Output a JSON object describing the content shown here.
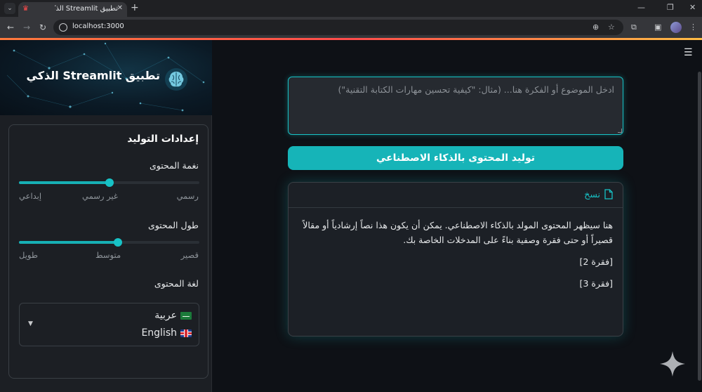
{
  "browser": {
    "tab_title": "تطبيق Streamlit الذكي",
    "url": "localhost:3000"
  },
  "sidebar": {
    "banner_title": "تطبيق Streamlit الذكي",
    "panel_title": "إعدادات التوليد",
    "tone": {
      "label": "نغمة المحتوى",
      "options": [
        "رسمي",
        "غير رسمي",
        "إبداعي"
      ],
      "selected": "غير رسمي",
      "value_fraction": 0.5
    },
    "length": {
      "label": "طول المحتوى",
      "options": [
        "قصير",
        "متوسط",
        "طويل"
      ],
      "selected": "متوسط",
      "value_fraction": 0.55
    },
    "language": {
      "label": "لغة المحتوى",
      "options": [
        {
          "text": "عربية",
          "flag": "saudi-flag"
        },
        {
          "text": "English",
          "flag": "uk-flag"
        }
      ]
    }
  },
  "main": {
    "topic_placeholder": "ادخل الموضوع أو الفكرة هنا... (مثال: \"كيفية تحسين مهارات الكتابة التقنية\")",
    "generate_label": "توليد المحتوى بالذكاء الاصطناعي",
    "copy_label": "نسخ",
    "output_paragraphs": [
      "هنا سيظهر المحتوى المولد بالذكاء الاصطناعي. يمكن أن يكون هذا نصاً إرشادياً أو مقالاً قصيراً أو حتى فقرة وصفية بناءً على المدخلات الخاصة بك.",
      "[فقرة 2]",
      "[فقرة 3]"
    ]
  },
  "colors": {
    "accent": "#17c2c6",
    "button": "#16b4b8",
    "background": "#0e1116",
    "sidebar": "#1c1f24"
  }
}
